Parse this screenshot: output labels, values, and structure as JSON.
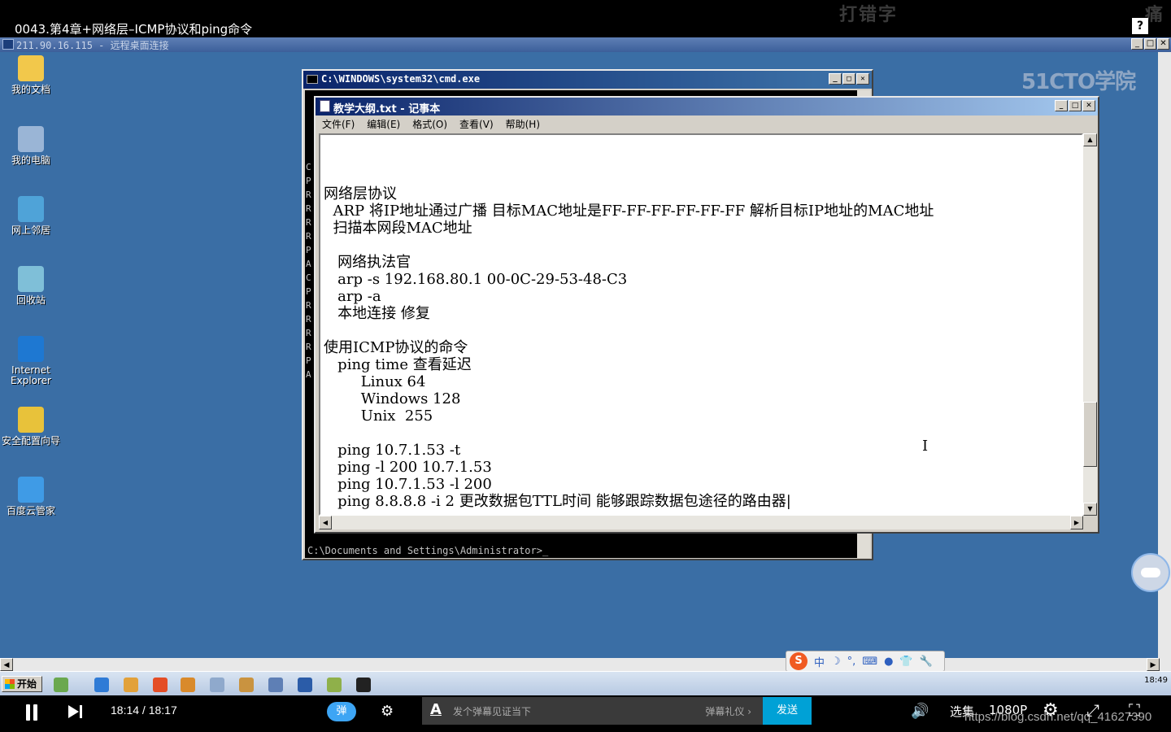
{
  "video": {
    "title": "0043.第4章+网络层–ICMP协议和ping命令",
    "watermark_top": "打错字",
    "watermark_top_right": "痛",
    "help_button": "?"
  },
  "remote": {
    "title": "211.90.16.115 - 远程桌面连接",
    "btn_min": "_",
    "btn_max": "□",
    "btn_close": "✕"
  },
  "desktop_icons": [
    {
      "label": "我的文档",
      "icon": "my-documents-icon",
      "color": "#f2c84b"
    },
    {
      "label": "我的电脑",
      "icon": "my-computer-icon",
      "color": "#9ab5d6"
    },
    {
      "label": "网上邻居",
      "icon": "network-icon",
      "color": "#4fa3d8"
    },
    {
      "label": "回收站",
      "icon": "recycle-bin-icon",
      "color": "#7fbfd8"
    },
    {
      "label": "Internet Explorer",
      "icon": "ie-icon",
      "color": "#1e78d2"
    },
    {
      "label": "安全配置向导",
      "icon": "security-wizard-icon",
      "color": "#e8c23a"
    },
    {
      "label": "百度云管家",
      "icon": "baidu-cloud-icon",
      "color": "#3f9be6"
    }
  ],
  "watermark_51cto": "51CTO学院",
  "cmd": {
    "title": "C:\\WINDOWS\\system32\\cmd.exe",
    "prompt": "C:\\Documents and Settings\\Administrator>_",
    "side_chars": [
      "C",
      "",
      "P",
      "",
      "R",
      "R",
      "R",
      "R",
      "",
      "P",
      "",
      "A",
      "",
      "",
      "C",
      "",
      "P",
      "",
      "R",
      "R",
      "R",
      "R",
      "",
      "P",
      "",
      "A"
    ]
  },
  "notepad": {
    "title": "教学大纲.txt - 记事本",
    "menu": [
      "文件(F)",
      "编辑(E)",
      "格式(O)",
      "查看(V)",
      "帮助(H)"
    ],
    "lines": [
      "",
      "网络层协议",
      "  ARP 将IP地址通过广播 目标MAC地址是FF-FF-FF-FF-FF-FF 解析目标IP地址的MAC地址",
      "  扫描本网段MAC地址",
      "",
      "   网络执法官",
      "   arp -s 192.168.80.1 00-0C-29-53-48-C3",
      "   arp -a",
      "   本地连接 修复",
      "",
      "使用ICMP协议的命令",
      "   ping time 查看延迟",
      "        Linux 64",
      "        Windows 128",
      "        Unix  255",
      "",
      "   ping 10.7.1.53 -t",
      "   ping -l 200 10.7.1.53",
      "   ping 10.7.1.53 -l 200",
      "   ping 8.8.8.8 -i 2 更改数据包TTL时间 能够跟踪数据包途径的路由器|"
    ]
  },
  "ime": {
    "logo": "S",
    "items": [
      "中",
      "☽",
      "°,",
      "⌨",
      "●",
      "👕",
      "🔧"
    ]
  },
  "taskbar": {
    "start": "开始",
    "tray_time": "18:49"
  },
  "player": {
    "time": "18:14 / 18:17",
    "danmu_label": "弹",
    "input_placeholder": "发个弹幕见证当下",
    "gift": "弹幕礼仪 ›",
    "send": "发送",
    "select": "选集",
    "quality": "1080P",
    "url_watermark": "https://blog.csdn.net/qq_41627390"
  },
  "colors": {
    "desktop": "#3a6ea5",
    "accent": "#00a1d6"
  }
}
